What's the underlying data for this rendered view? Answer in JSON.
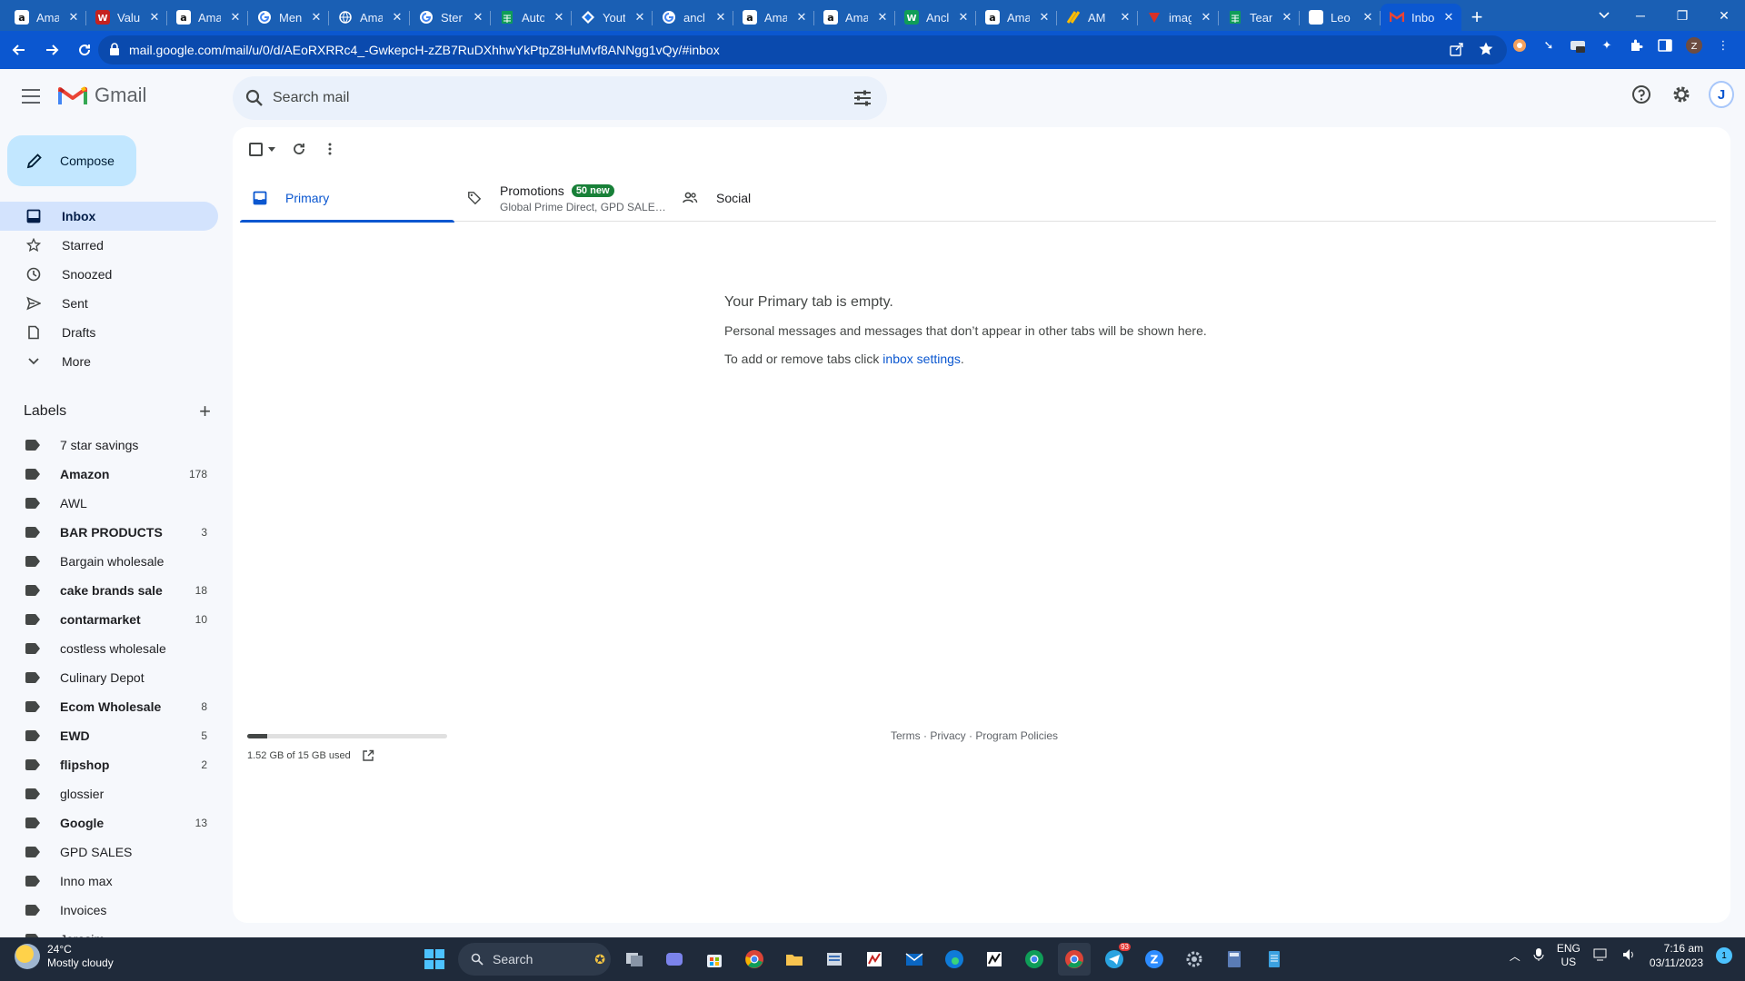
{
  "browser": {
    "tabs": [
      {
        "label": "Ama",
        "favicon": "amazon-icon",
        "color": "#111111"
      },
      {
        "label": "Valu",
        "favicon": "w-icon",
        "color": "#c5221f"
      },
      {
        "label": "Ama",
        "favicon": "amazon-icon",
        "color": "#111111"
      },
      {
        "label": "Men",
        "favicon": "google-icon",
        "color": "#ffffff"
      },
      {
        "label": "Ama",
        "favicon": "globe-icon",
        "color": "#5f6368"
      },
      {
        "label": "Ster",
        "favicon": "google-icon",
        "color": "#ffffff"
      },
      {
        "label": "Auto",
        "favicon": "sheets-icon",
        "color": "#0f9d58"
      },
      {
        "label": "Yout",
        "favicon": "diamond-icon",
        "color": "#1a73e8"
      },
      {
        "label": "ancl",
        "favicon": "google-icon",
        "color": "#ffffff"
      },
      {
        "label": "Ama",
        "favicon": "amazon-icon",
        "color": "#111111"
      },
      {
        "label": "Ama",
        "favicon": "amazon-icon",
        "color": "#111111"
      },
      {
        "label": "Ancl",
        "favicon": "w-icon",
        "color": "#0f9d58"
      },
      {
        "label": "Ama",
        "favicon": "amazon-icon",
        "color": "#111111"
      },
      {
        "label": "AM",
        "favicon": "stripes-icon",
        "color": "#fbbc04"
      },
      {
        "label": "imag",
        "favicon": "v-icon",
        "color": "#d93025"
      },
      {
        "label": "Tean",
        "favicon": "sheets-icon",
        "color": "#0f9d58"
      },
      {
        "label": "Leo",
        "favicon": "w-icon",
        "color": "#ffffff"
      },
      {
        "label": "Inbo",
        "favicon": "gmail-icon",
        "color": "#ffffff",
        "active": true
      }
    ],
    "url": "mail.google.com/mail/u/0/d/AEoRXRRc4_-GwkepcH-zZB7RuDXhhwYkPtpZ8HuMvf8ANNgg1vQy/#inbox",
    "new_tab": "+",
    "close_glyph": "✕"
  },
  "gmail": {
    "brand": "Gmail",
    "search_placeholder": "Search mail",
    "avatar_initial": "J",
    "compose_label": "Compose",
    "nav": [
      {
        "label": "Inbox",
        "icon": "inbox-icon",
        "active": true
      },
      {
        "label": "Starred",
        "icon": "star-icon"
      },
      {
        "label": "Snoozed",
        "icon": "clock-icon"
      },
      {
        "label": "Sent",
        "icon": "send-icon"
      },
      {
        "label": "Drafts",
        "icon": "draft-icon"
      },
      {
        "label": "More",
        "icon": "chevron-down-icon"
      }
    ],
    "labels_heading": "Labels",
    "labels": [
      {
        "name": "7 star savings",
        "count": "",
        "bold": false
      },
      {
        "name": "Amazon",
        "count": "178",
        "bold": true
      },
      {
        "name": "AWL",
        "count": "",
        "bold": false
      },
      {
        "name": "BAR PRODUCTS",
        "count": "3",
        "bold": true
      },
      {
        "name": "Bargain wholesale",
        "count": "",
        "bold": false
      },
      {
        "name": "cake brands sale",
        "count": "18",
        "bold": true
      },
      {
        "name": "contarmarket",
        "count": "10",
        "bold": true
      },
      {
        "name": "costless wholesale",
        "count": "",
        "bold": false
      },
      {
        "name": "Culinary Depot",
        "count": "",
        "bold": false
      },
      {
        "name": "Ecom Wholesale",
        "count": "8",
        "bold": true
      },
      {
        "name": "EWD",
        "count": "5",
        "bold": true
      },
      {
        "name": "flipshop",
        "count": "2",
        "bold": true
      },
      {
        "name": "glossier",
        "count": "",
        "bold": false
      },
      {
        "name": "Google",
        "count": "13",
        "bold": true
      },
      {
        "name": "GPD SALES",
        "count": "",
        "bold": false
      },
      {
        "name": "Inno max",
        "count": "",
        "bold": false
      },
      {
        "name": "Invoices",
        "count": "",
        "bold": false
      },
      {
        "name": "Jerasim",
        "count": "",
        "bold": false
      }
    ],
    "inbox_tabs": {
      "primary": "Primary",
      "promotions": "Promotions",
      "promotions_badge": "50 new",
      "promotions_sub": "Global Prime Direct, GPD SALES...",
      "social": "Social"
    },
    "empty": {
      "title": "Your Primary tab is empty.",
      "line1": "Personal messages and messages that don’t appear in other tabs will be shown here.",
      "line2_prefix": "To add or remove tabs click ",
      "line2_link": "inbox settings",
      "line2_suffix": "."
    },
    "storage": {
      "text": "1.52 GB of 15 GB used",
      "fraction": 0.1
    },
    "footer": {
      "terms": "Terms",
      "sep": " · ",
      "privacy": "Privacy",
      "policies": "Program Policies"
    }
  },
  "taskbar": {
    "weather_temp": "24°C",
    "weather_desc": "Mostly cloudy",
    "search_label": "Search",
    "lang_line1": "ENG",
    "lang_line2": "US",
    "time": "7:16 am",
    "date": "03/11/2023",
    "notif_count": "1",
    "telegram_badge": "93"
  },
  "colors": {
    "accent": "#0b57d0",
    "compose_bg": "#c2e7ff",
    "active_nav": "#d3e3fd",
    "promotions_badge": "#188038"
  }
}
